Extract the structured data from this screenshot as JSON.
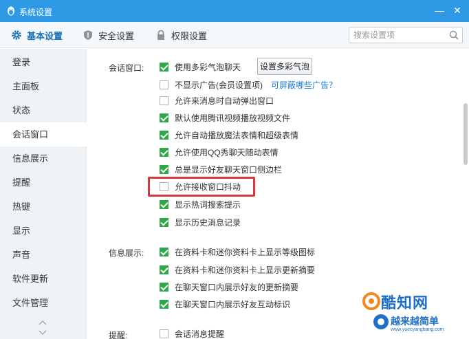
{
  "window": {
    "title": "系统设置",
    "minimize_glyph": "—",
    "close_glyph": "✕"
  },
  "tabs": [
    {
      "label": "基本设置",
      "icon": "gear-icon",
      "active": true
    },
    {
      "label": "安全设置",
      "icon": "shield-icon",
      "active": false
    },
    {
      "label": "权限设置",
      "icon": "lock-icon",
      "active": false
    }
  ],
  "search": {
    "placeholder": "搜索设置项",
    "icon": "search-icon"
  },
  "sidebar": {
    "items": [
      {
        "label": "登录"
      },
      {
        "label": "主面板"
      },
      {
        "label": "状态"
      },
      {
        "label": "会话窗口",
        "active": true
      },
      {
        "label": "信息展示"
      },
      {
        "label": "提醒"
      },
      {
        "label": "热键"
      },
      {
        "label": "显示"
      },
      {
        "label": "声音"
      },
      {
        "label": "软件更新"
      },
      {
        "label": "文件管理"
      }
    ]
  },
  "sections": {
    "session": {
      "label": "会话窗口:",
      "button_label": "设置多彩气泡",
      "link_label": "可屏蔽哪些广告？",
      "options": [
        {
          "label": "使用多彩气泡聊天",
          "checked": true
        },
        {
          "label": "不显示广告(会员设置项)",
          "checked": false
        },
        {
          "label": "允许来消息时自动弹出窗口",
          "checked": false
        },
        {
          "label": "默认使用腾讯视频播放视频文件",
          "checked": true
        },
        {
          "label": "允许自动播放魔法表情和超级表情",
          "checked": true
        },
        {
          "label": "允许使用QQ秀聊天随动表情",
          "checked": true
        },
        {
          "label": "总是显示好友聊天窗口侧边栏",
          "checked": true
        },
        {
          "label": "允许接收窗口抖动",
          "checked": false
        },
        {
          "label": "显示热词搜索提示",
          "checked": true
        },
        {
          "label": "显示历史消息记录",
          "checked": true
        }
      ]
    },
    "info": {
      "label": "信息展示:",
      "options": [
        {
          "label": "在资料卡和迷你资料卡上显示等级图标",
          "checked": true
        },
        {
          "label": "在资料卡和迷你资料卡上显示更新摘要",
          "checked": true
        },
        {
          "label": "在聊天窗口内展示好友的更新摘要",
          "checked": true
        },
        {
          "label": "在聊天窗口内展示好友互动标识",
          "checked": true
        }
      ]
    },
    "remind": {
      "label": "提醒:",
      "options": [
        {
          "label": "会话消息提醒",
          "checked": false
        }
      ]
    }
  },
  "watermark": {
    "text1": "酷知网",
    "text2": "越来越简单",
    "url": "www.yuecyangbang.com",
    "colors": {
      "orange": "#f08a1c",
      "blue": "#1e6fc9"
    }
  },
  "colors": {
    "titlebar": "#2e9ae6",
    "checkbox": "#2fa84a",
    "link": "#1a7bd6",
    "highlight": "#d9363a"
  }
}
